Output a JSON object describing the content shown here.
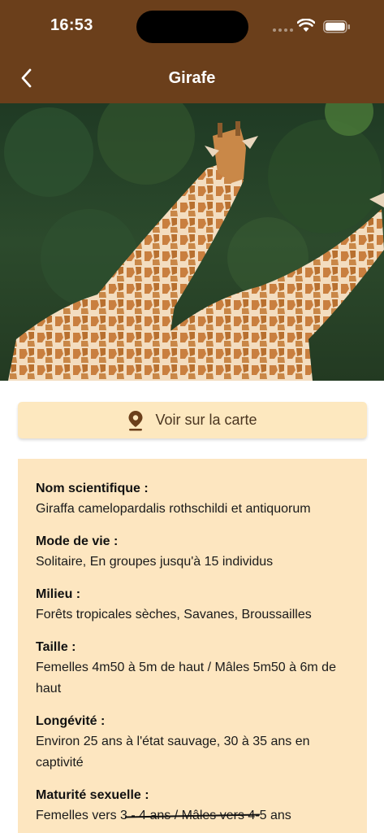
{
  "status_bar": {
    "time": "16:53"
  },
  "header": {
    "title": "Girafe",
    "back_icon": "chevron-left-icon"
  },
  "hero": {
    "alt": "two giraffes in front of trees"
  },
  "map_button": {
    "label": "Voir sur la carte",
    "icon": "map-pin-icon"
  },
  "info": [
    {
      "label": "Nom scientifique :",
      "value": "Giraffa camelopardalis rothschildi et antiquorum"
    },
    {
      "label": "Mode de vie :",
      "value": "Solitaire, En groupes jusqu'à 15 individus"
    },
    {
      "label": "Milieu :",
      "value": "Forêts tropicales sèches, Savanes, Broussailles"
    },
    {
      "label": "Taille :",
      "value": "Femelles 4m50 à 5m de haut / Mâles 5m50 à 6m de haut"
    },
    {
      "label": "Longévité :",
      "value": "Environ 25 ans à l'état sauvage, 30 à 35 ans en captivité"
    },
    {
      "label": "Maturité sexuelle  :",
      "value": "Femelles vers 3 - 4 ans / Mâles vers 4-5 ans"
    }
  ],
  "colors": {
    "header": "#6b3f1b",
    "card": "#fde6c0",
    "button": "#fde8bf",
    "pin": "#6b3f1b"
  }
}
